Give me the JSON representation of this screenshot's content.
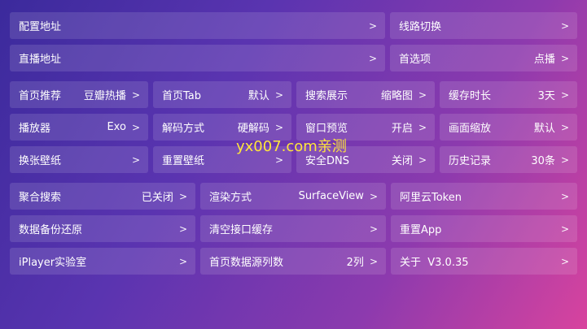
{
  "rows": [
    [
      {
        "label": "配置地址",
        "value": "",
        "chev": ">"
      },
      {
        "label": "线路切换",
        "value": "",
        "chev": ">"
      }
    ],
    [
      {
        "label": "直播地址",
        "value": "",
        "chev": ">"
      },
      {
        "label": "首选项",
        "value": "点播",
        "chev": ">"
      }
    ],
    [
      {
        "label": "首页推荐",
        "value": "豆瓣热播",
        "chev": ">"
      },
      {
        "label": "首页Tab",
        "value": "默认",
        "chev": ">"
      },
      {
        "label": "搜索展示",
        "value": "缩略图",
        "chev": ">"
      },
      {
        "label": "缓存时长",
        "value": "3天",
        "chev": ">"
      }
    ],
    [
      {
        "label": "播放器",
        "value": "Exo",
        "chev": ">"
      },
      {
        "label": "解码方式",
        "value": "硬解码",
        "chev": ">"
      },
      {
        "label": "窗口预览",
        "value": "开启",
        "chev": ">"
      },
      {
        "label": "画面缩放",
        "value": "默认",
        "chev": ">"
      }
    ],
    [
      {
        "label": "换张壁纸",
        "value": "",
        "chev": ">"
      },
      {
        "label": "重置壁纸",
        "value": "",
        "chev": ">"
      },
      {
        "label": "安全DNS",
        "value": "关闭",
        "chev": ">"
      },
      {
        "label": "历史记录",
        "value": "30条",
        "chev": ">"
      }
    ],
    [
      {
        "label": "聚合搜索",
        "value": "已关闭",
        "chev": ">"
      },
      {
        "label": "渲染方式",
        "value": "SurfaceView",
        "chev": ">"
      },
      {
        "label": "阿里云Token",
        "value": "",
        "chev": ">"
      }
    ],
    [
      {
        "label": "数据备份还原",
        "value": "",
        "chev": ">"
      },
      {
        "label": "清空接口缓存",
        "value": "",
        "chev": ">"
      },
      {
        "label": "重置App",
        "value": "",
        "chev": ">"
      }
    ],
    [
      {
        "label": "iPlayer实验室",
        "value": "",
        "chev": ">"
      },
      {
        "label": "首页数据源列数",
        "value": "2列",
        "chev": ">"
      },
      {
        "label": "关于  V3.0.35",
        "value": "",
        "chev": ">"
      }
    ]
  ],
  "watermark": "yx007.com亲测"
}
